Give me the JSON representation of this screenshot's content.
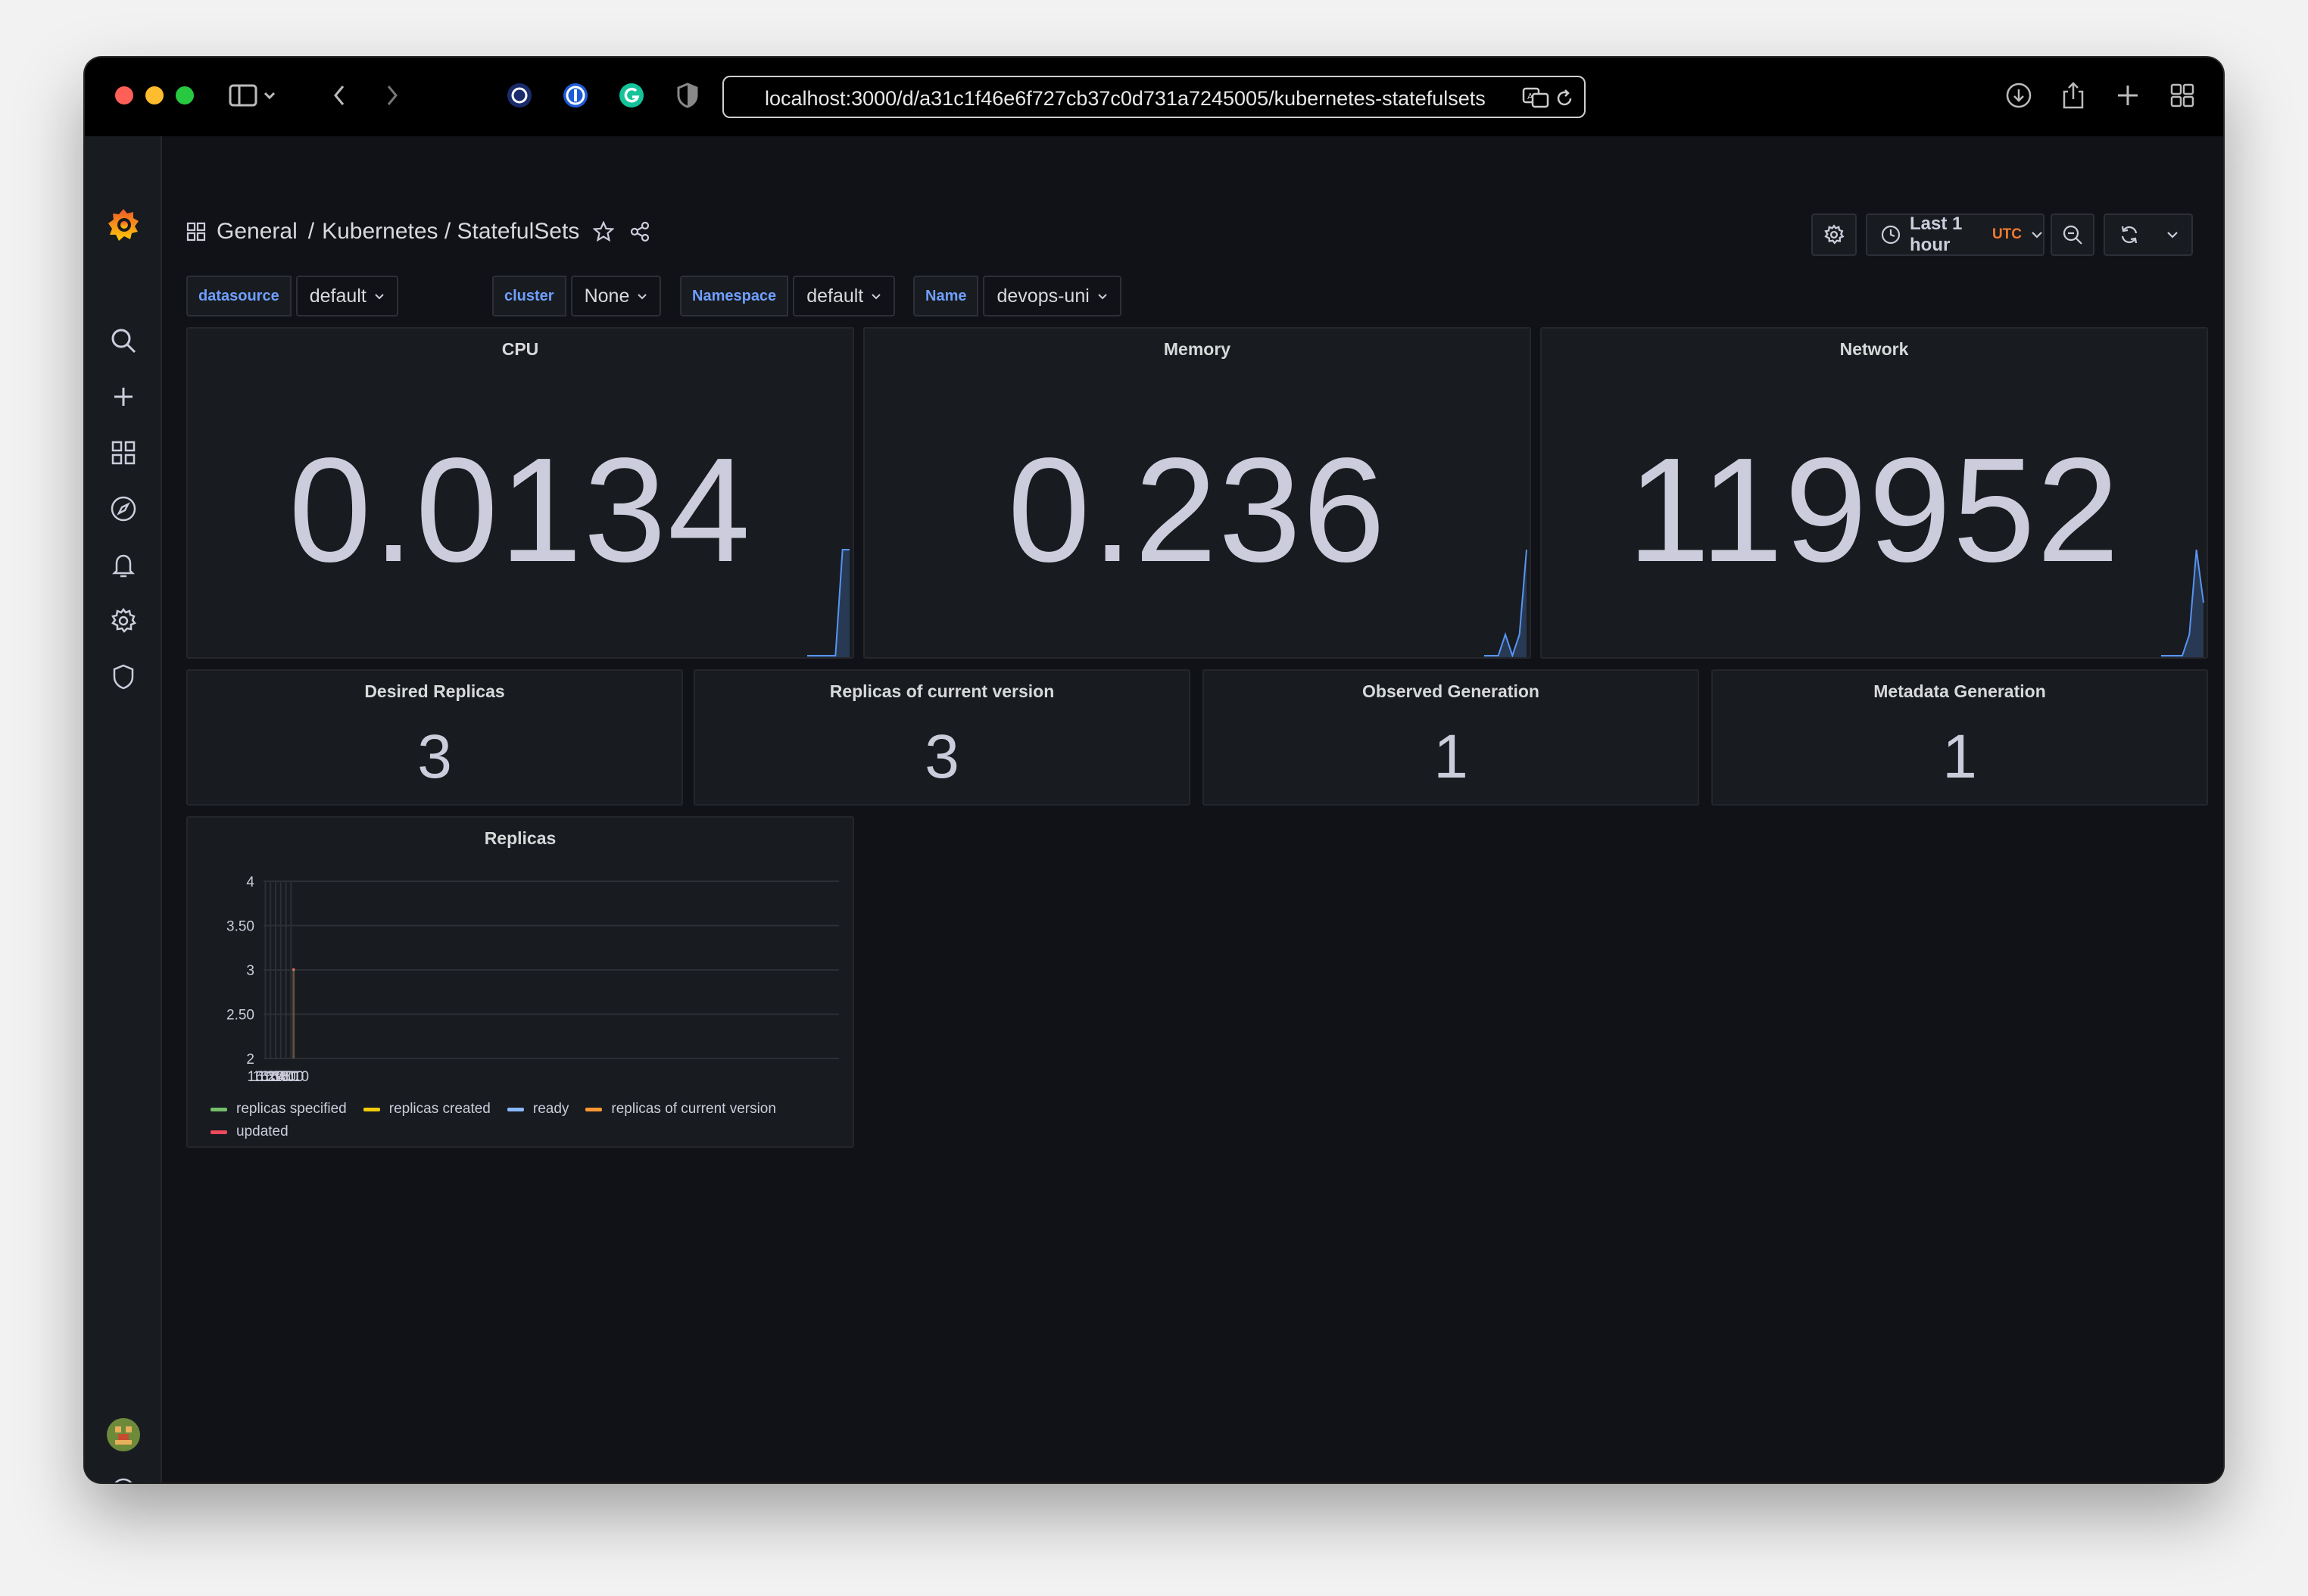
{
  "browser": {
    "url": "localhost:3000/d/a31c1f46e6f727cb37c0d731a7245005/kubernetes-statefulsets"
  },
  "header": {
    "breadcrumb_folder": "General",
    "breadcrumb_sep": "/",
    "breadcrumb_title": "Kubernetes / StatefulSets",
    "time_range": "Last 1 hour",
    "timezone": "UTC"
  },
  "variables": [
    {
      "label": "datasource",
      "value": "default"
    },
    {
      "label": "cluster",
      "value": "None"
    },
    {
      "label": "Namespace",
      "value": "default"
    },
    {
      "label": "Name",
      "value": "devops-uni"
    }
  ],
  "stats_large": [
    {
      "title": "CPU",
      "value": "0.0134",
      "sparkline": [
        0,
        0,
        0,
        0,
        0,
        1,
        1
      ]
    },
    {
      "title": "Memory",
      "value": "0.236",
      "sparkline": [
        0,
        0,
        0,
        0.2,
        0,
        0.2,
        1
      ]
    },
    {
      "title": "Network",
      "value": "119952",
      "sparkline": [
        0,
        0,
        0,
        0,
        0.2,
        1,
        0.5
      ]
    }
  ],
  "stats_small": [
    {
      "title": "Desired Replicas",
      "value": "3"
    },
    {
      "title": "Replicas of current version",
      "value": "3"
    },
    {
      "title": "Observed Generation",
      "value": "1"
    },
    {
      "title": "Metadata Generation",
      "value": "1"
    }
  ],
  "colors": {
    "accent": "#f27a32",
    "background": "#111217",
    "panel": "#181b1f",
    "spark": "#5794f2",
    "bar_fill": "#6b5a44"
  },
  "chart_data": {
    "type": "area",
    "title": "Replicas",
    "x_ticks": [
      "16:20",
      "16:30",
      "16:40",
      "16:50",
      "17:00",
      "17:10"
    ],
    "y_ticks": [
      "4",
      "3.50",
      "3",
      "2.50",
      "2"
    ],
    "ylim": [
      2,
      4
    ],
    "xlim_minutes": [
      16.4,
      1137
    ],
    "series": [
      {
        "name": "replicas specified",
        "color": "#73bf69",
        "points": [
          [
            "17:13",
            3
          ],
          [
            "17:17",
            3
          ]
        ]
      },
      {
        "name": "replicas created",
        "color": "#f2cc0c",
        "points": [
          [
            "17:13",
            3
          ],
          [
            "17:17",
            3
          ]
        ]
      },
      {
        "name": "ready",
        "color": "#8ab8ff",
        "points": [
          [
            "17:13",
            3
          ],
          [
            "17:17",
            3
          ]
        ]
      },
      {
        "name": "replicas of current version",
        "color": "#ff9830",
        "points": [
          [
            "17:13",
            3
          ],
          [
            "17:17",
            3
          ]
        ]
      },
      {
        "name": "updated",
        "color": "#f2495c",
        "points": [
          [
            "17:13",
            3
          ],
          [
            "17:17",
            3
          ]
        ]
      }
    ],
    "grid": true,
    "legend_position": "bottom"
  }
}
